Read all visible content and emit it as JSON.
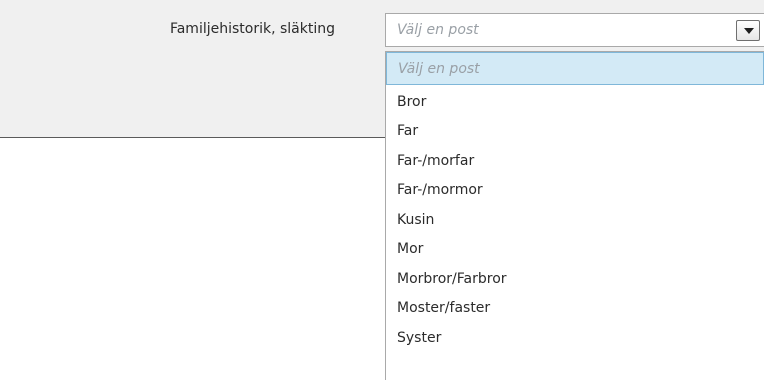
{
  "field": {
    "label": "Familjehistorik, släkting",
    "placeholder": "Välj en post"
  },
  "select": {
    "arrow_icon": "chevron-down-icon"
  },
  "dropdown": {
    "options": [
      {
        "label": "Välj en post",
        "is_placeholder": true,
        "highlighted": true
      },
      {
        "label": "Bror"
      },
      {
        "label": "Far"
      },
      {
        "label": "Far-/morfar"
      },
      {
        "label": "Far-/mormor"
      },
      {
        "label": "Kusin"
      },
      {
        "label": "Mor"
      },
      {
        "label": "Morbror/Farbror"
      },
      {
        "label": "Moster/faster"
      },
      {
        "label": "Syster"
      }
    ]
  },
  "colors": {
    "highlight_bg": "#d3eaf6",
    "highlight_border": "#7fb7d9",
    "placeholder_text": "#9aa0a6"
  }
}
